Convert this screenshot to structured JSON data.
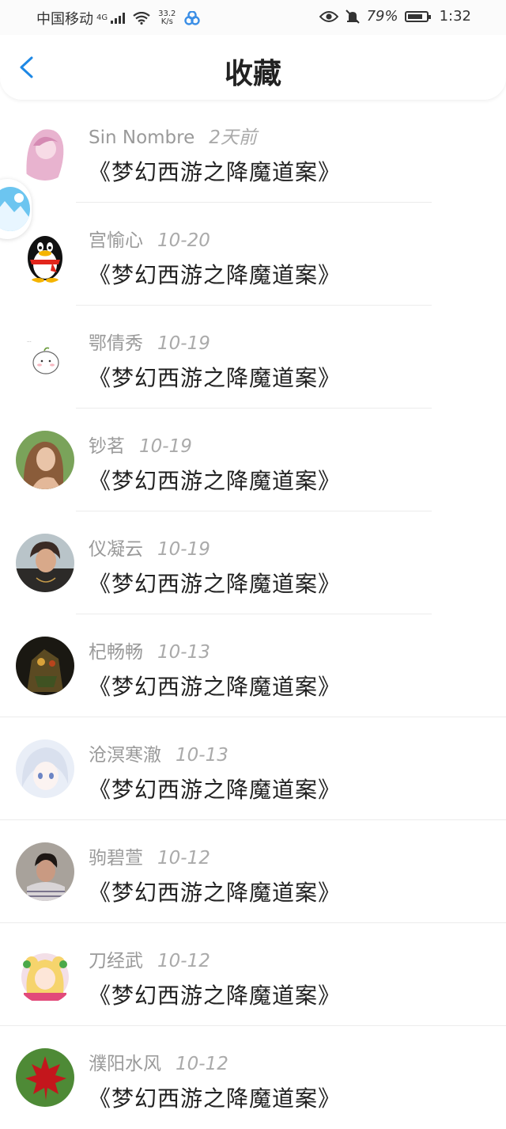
{
  "status_bar": {
    "carrier": "中国移动",
    "network_type": "4G",
    "speed_value": "33.2",
    "speed_unit": "K/s",
    "battery": "79%",
    "time": "1:32"
  },
  "header": {
    "title": "收藏"
  },
  "favorites": [
    {
      "user": "Sin Nombre",
      "date": "2天前",
      "work": "《梦幻西游之降魔道案》",
      "avatar": "anime-girl-avatar"
    },
    {
      "user": "宫愉心",
      "date": "10-20",
      "work": "《梦幻西游之降魔道案》",
      "avatar": "penguin-avatar"
    },
    {
      "user": "鄂倩秀",
      "date": "10-19",
      "work": "《梦幻西游之降魔道案》",
      "avatar": "cartoon-bun-avatar"
    },
    {
      "user": "钞茗",
      "date": "10-19",
      "work": "《梦幻西游之降魔道案》",
      "avatar": "photo-woman-avatar"
    },
    {
      "user": "仪凝云",
      "date": "10-19",
      "work": "《梦幻西游之降魔道案》",
      "avatar": "photo-person-avatar"
    },
    {
      "user": "杞畅畅",
      "date": "10-13",
      "work": "《梦幻西游之降魔道案》",
      "avatar": "robot-avatar"
    },
    {
      "user": "沧溟寒澈",
      "date": "10-13",
      "work": "《梦幻西游之降魔道案》",
      "avatar": "anime-boy-avatar"
    },
    {
      "user": "驹碧萱",
      "date": "10-12",
      "work": "《梦幻西游之降魔道案》",
      "avatar": "photo-boy-avatar"
    },
    {
      "user": "刀经武",
      "date": "10-12",
      "work": "《梦幻西游之降魔道案》",
      "avatar": "sailor-moon-avatar"
    },
    {
      "user": "濮阳水风",
      "date": "10-12",
      "work": "《梦幻西游之降魔道案》",
      "avatar": "maple-leaf-avatar"
    }
  ],
  "colors": {
    "accent": "#1e88e5",
    "meta_text": "#9a9a9a",
    "divider": "#ececec"
  }
}
